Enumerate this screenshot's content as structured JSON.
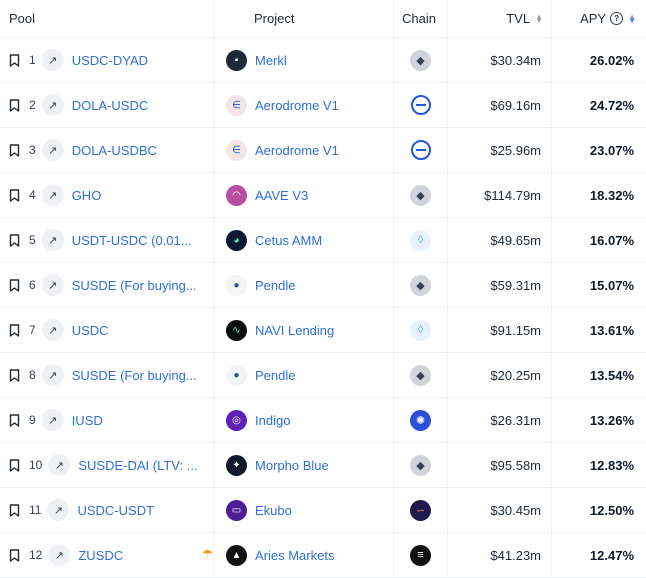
{
  "header": {
    "pool": "Pool",
    "project": "Project",
    "chain": "Chain",
    "tvl": "TVL",
    "apy": "APY",
    "apy_help": "?"
  },
  "rows": [
    {
      "rank": "1",
      "pool": "USDC-DYAD",
      "project": "Merkl",
      "project_icon": "merkl-icon",
      "chain_icon": "ethereum-icon",
      "tvl": "$30.34m",
      "apy": "26.02%"
    },
    {
      "rank": "2",
      "pool": "DOLA-USDC",
      "project": "Aerodrome V1",
      "project_icon": "aerodrome-icon",
      "chain_icon": "base-icon",
      "tvl": "$69.16m",
      "apy": "24.72%"
    },
    {
      "rank": "3",
      "pool": "DOLA-USDBC",
      "project": "Aerodrome V1",
      "project_icon": "aerodrome-icon",
      "chain_icon": "base-icon",
      "tvl": "$25.96m",
      "apy": "23.07%"
    },
    {
      "rank": "4",
      "pool": "GHO",
      "project": "AAVE V3",
      "project_icon": "aave-icon",
      "chain_icon": "ethereum-icon",
      "tvl": "$114.79m",
      "apy": "18.32%"
    },
    {
      "rank": "5",
      "pool": "USDT-USDC (0.01...",
      "project": "Cetus AMM",
      "project_icon": "cetus-icon",
      "chain_icon": "sui-icon",
      "tvl": "$49.65m",
      "apy": "16.07%"
    },
    {
      "rank": "6",
      "pool": "SUSDE (For buying...",
      "project": "Pendle",
      "project_icon": "pendle-icon",
      "chain_icon": "ethereum-icon",
      "tvl": "$59.31m",
      "apy": "15.07%"
    },
    {
      "rank": "7",
      "pool": "USDC",
      "project": "NAVI Lending",
      "project_icon": "navi-icon",
      "chain_icon": "sui-icon",
      "tvl": "$91.15m",
      "apy": "13.61%"
    },
    {
      "rank": "8",
      "pool": "SUSDE (For buying...",
      "project": "Pendle",
      "project_icon": "pendle-icon",
      "chain_icon": "ethereum-icon",
      "tvl": "$20.25m",
      "apy": "13.54%"
    },
    {
      "rank": "9",
      "pool": "IUSD",
      "project": "Indigo",
      "project_icon": "indigo-icon",
      "chain_icon": "cardano-icon",
      "tvl": "$26.31m",
      "apy": "13.26%"
    },
    {
      "rank": "10",
      "pool": "SUSDE-DAI (LTV: ...",
      "project": "Morpho Blue",
      "project_icon": "morpho-icon",
      "chain_icon": "ethereum-icon",
      "tvl": "$95.58m",
      "apy": "12.83%"
    },
    {
      "rank": "11",
      "pool": "USDC-USDT",
      "project": "Ekubo",
      "project_icon": "ekubo-icon",
      "chain_icon": "starknet-icon",
      "tvl": "$30.45m",
      "apy": "12.50%"
    },
    {
      "rank": "12",
      "pool": "ZUSDC",
      "project": "Aries Markets",
      "project_icon": "aries-icon",
      "chain_icon": "aptos-icon",
      "tvl": "$41.23m",
      "apy": "12.47%"
    }
  ]
}
